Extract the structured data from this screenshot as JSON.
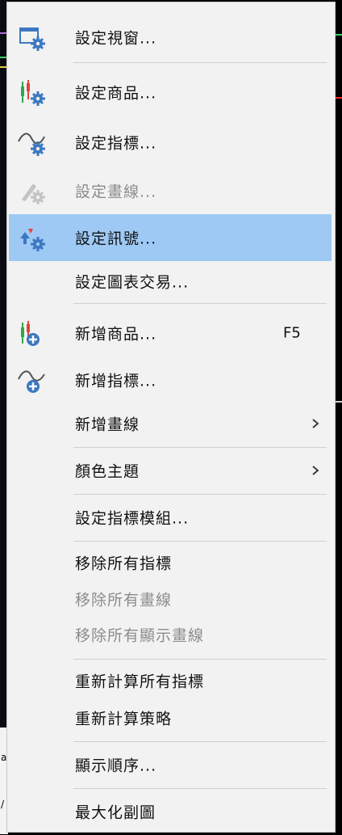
{
  "menu": {
    "items": [
      {
        "label": "設定視窗...",
        "icon": "window-settings-icon"
      },
      {
        "label": "設定商品...",
        "icon": "symbol-settings-icon"
      },
      {
        "label": "設定指標...",
        "icon": "indicator-settings-icon"
      },
      {
        "label": "設定畫線...",
        "icon": "drawing-settings-icon",
        "disabled": true
      },
      {
        "label": "設定訊號...",
        "icon": "signal-settings-icon",
        "highlighted": true
      },
      {
        "label": "設定圖表交易..."
      },
      {
        "label": "新增商品...",
        "icon": "add-symbol-icon",
        "shortcut": "F5"
      },
      {
        "label": "新增指標...",
        "icon": "add-indicator-icon"
      },
      {
        "label": "新增畫線",
        "submenu": true
      },
      {
        "label": "顏色主題",
        "submenu": true
      },
      {
        "label": "設定指標模組..."
      },
      {
        "label": "移除所有指標"
      },
      {
        "label": "移除所有畫線",
        "disabled": true
      },
      {
        "label": "移除所有顯示畫線",
        "disabled": true
      },
      {
        "label": "重新計算所有指標"
      },
      {
        "label": "重新計算策略"
      },
      {
        "label": "顯示順序..."
      },
      {
        "label": "最大化副圖"
      }
    ]
  },
  "colors": {
    "menu_bg": "#f2f2f2",
    "highlight": "#9ec9f5",
    "disabled_text": "#8c8c8c",
    "gear_blue": "#3c78c0"
  }
}
